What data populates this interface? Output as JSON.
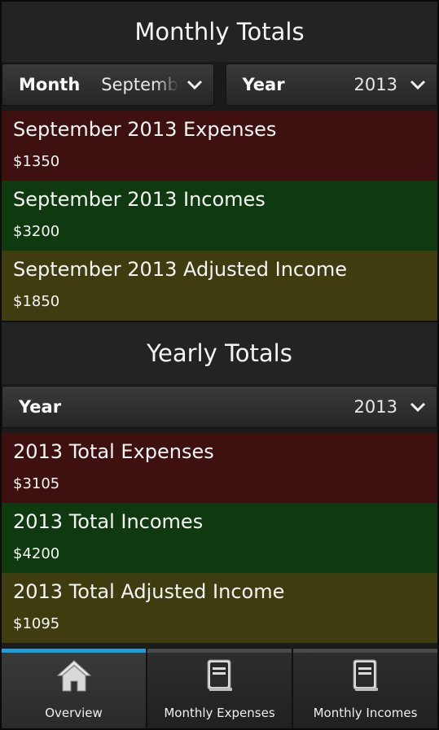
{
  "monthly": {
    "title": "Monthly Totals",
    "month_label": "Month",
    "month_value": "September",
    "year_label": "Year",
    "year_value": "2013",
    "expenses_title": "September 2013 Expenses",
    "expenses_value": "$1350",
    "incomes_title": "September 2013 Incomes",
    "incomes_value": "$3200",
    "adjusted_title": "September 2013 Adjusted Income",
    "adjusted_value": "$1850"
  },
  "yearly": {
    "title": "Yearly Totals",
    "year_label": "Year",
    "year_value": "2013",
    "expenses_title": "2013 Total Expenses",
    "expenses_value": "$3105",
    "incomes_title": "2013 Total Incomes",
    "incomes_value": "$4200",
    "adjusted_title": "2013 Total Adjusted Income",
    "adjusted_value": "$1095"
  },
  "tabs": [
    {
      "label": "Overview",
      "icon": "home-icon",
      "active": true
    },
    {
      "label": "Monthly Expenses",
      "icon": "document-icon",
      "active": false
    },
    {
      "label": "Monthly Incomes",
      "icon": "document-icon",
      "active": false
    }
  ],
  "colors": {
    "expense": "#3e1010",
    "income": "#0f3a10",
    "adjusted": "#3f3c10",
    "active_tab_indicator": "#1aa0dd"
  }
}
